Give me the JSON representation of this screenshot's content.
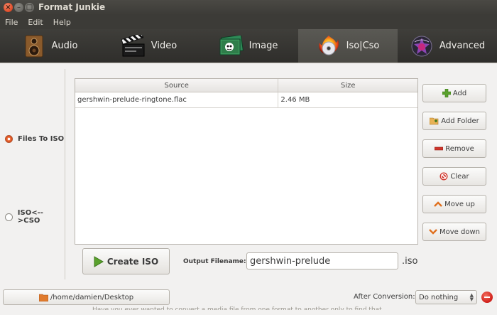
{
  "window": {
    "title": "Format Junkie",
    "close_glyph": "×",
    "min_glyph": "–",
    "max_glyph": "□"
  },
  "menu": {
    "items": [
      "File",
      "Edit",
      "Help"
    ]
  },
  "tabs": [
    {
      "label": "Audio",
      "icon": "speaker-icon",
      "active": false
    },
    {
      "label": "Video",
      "icon": "clapperboard-icon",
      "active": false
    },
    {
      "label": "Image",
      "icon": "image-icon",
      "active": false
    },
    {
      "label": "Iso|Cso",
      "icon": "disc-icon",
      "active": true
    },
    {
      "label": "Advanced",
      "icon": "advanced-icon",
      "active": false
    }
  ],
  "mode": {
    "options": [
      "Files To ISO",
      "ISO<-->CSO"
    ],
    "selected": "Files To ISO"
  },
  "table": {
    "columns": [
      "Source",
      "Size"
    ],
    "rows": [
      {
        "source": "gershwin-prelude-ringtone.flac",
        "size": "2.46 MB"
      }
    ]
  },
  "side_buttons": {
    "add": "Add",
    "add_folder": "Add Folder",
    "remove": "Remove",
    "clear": "Clear",
    "move_up": "Move up",
    "move_down": "Move down"
  },
  "create": {
    "button_label": "Create ISO"
  },
  "output": {
    "label": "Output Filename:",
    "value": "gershwin-prelude",
    "extension": ".iso"
  },
  "bottom": {
    "path": "/home/damien/Desktop",
    "after_label": "After Conversion:",
    "after_value": "Do nothing",
    "ghost_text": "Have you ever wanted to convert a media file from one format to another only to find that"
  },
  "colors": {
    "accent": "#dd4814",
    "titlebar": "#3c3b37",
    "tab_active": "#4a4944"
  }
}
